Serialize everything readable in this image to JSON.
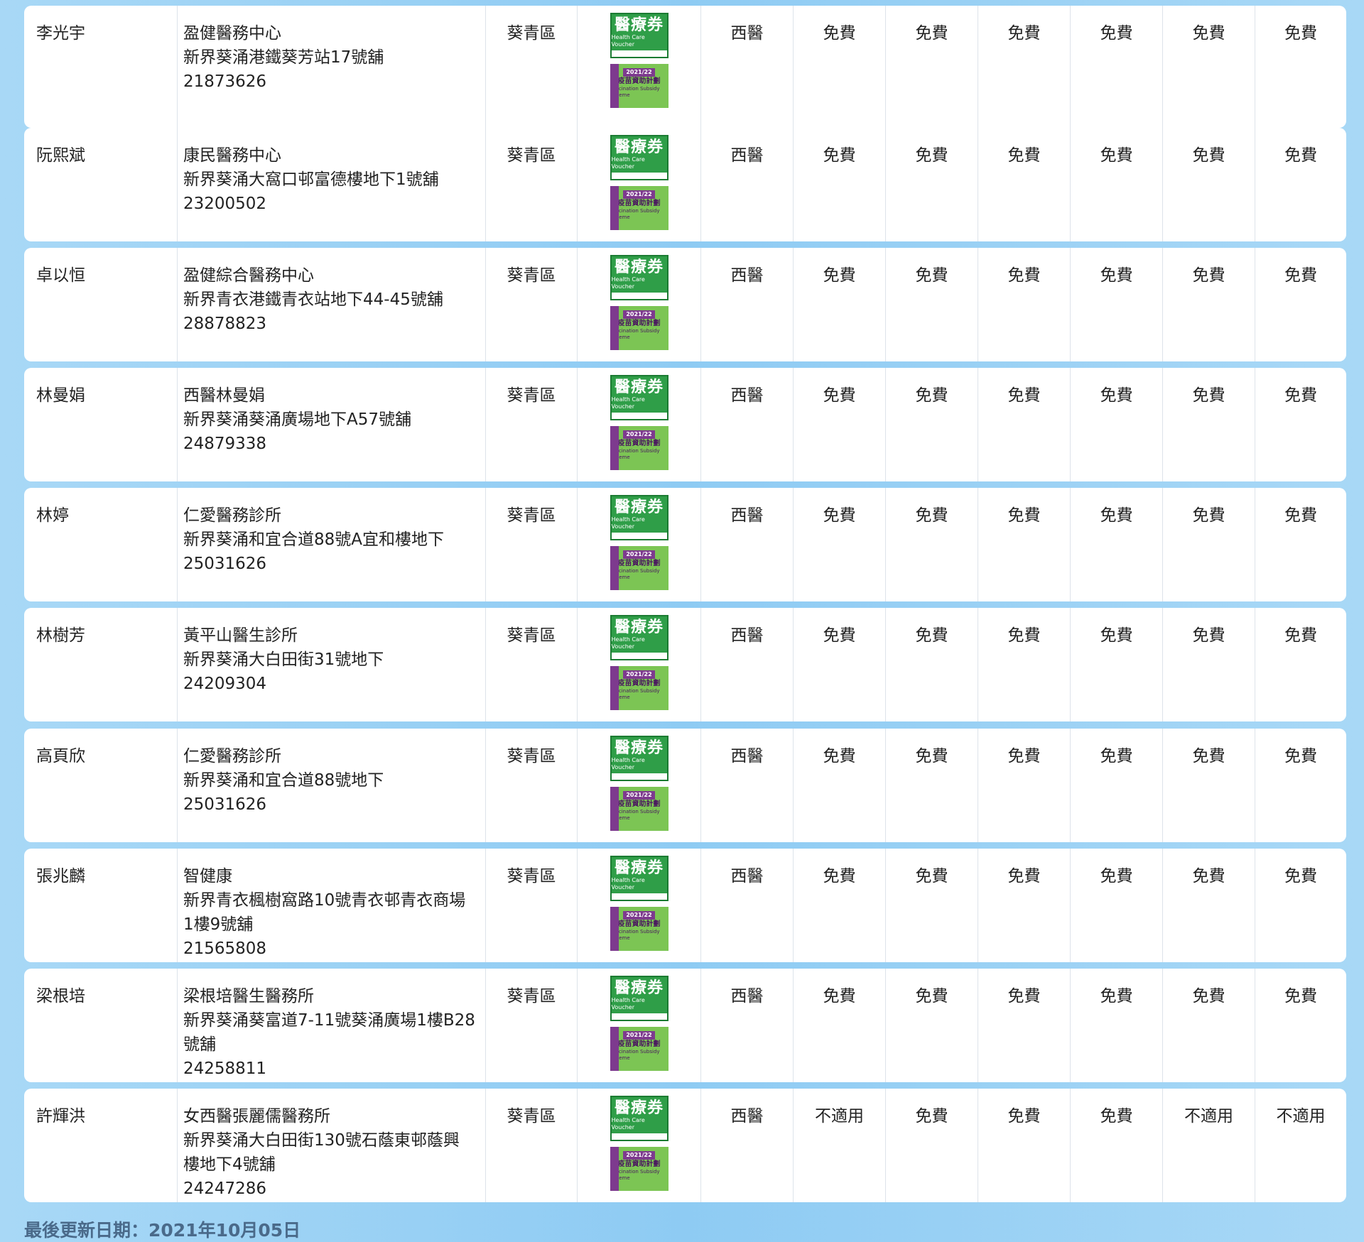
{
  "badges": {
    "hcv_title": "醫療券",
    "hcv_sub": "Health Care Voucher",
    "vss_year": "2021/22",
    "vss_title": "疫苗資助計劃",
    "vss_sub": "Vaccination Subsidy Scheme"
  },
  "rows": [
    {
      "doctor": "李光宇",
      "clinic": "盈健醫務中心",
      "address": "新界葵涌港鐵葵芳站17號舖",
      "address2": "",
      "phone": "21873626",
      "district": "葵青區",
      "type": "西醫",
      "fees": [
        "免費",
        "免費",
        "免費",
        "免費",
        "免費",
        "免費"
      ]
    },
    {
      "doctor": "阮熙斌",
      "clinic": "康民醫務中心",
      "address": "新界葵涌大窩口邨富德樓地下1號舖",
      "address2": "",
      "phone": "23200502",
      "district": "葵青區",
      "type": "西醫",
      "fees": [
        "免費",
        "免費",
        "免費",
        "免費",
        "免費",
        "免費"
      ]
    },
    {
      "doctor": "卓以恒",
      "clinic": "盈健綜合醫務中心",
      "address": "新界青衣港鐵青衣站地下44-45號舖",
      "address2": "",
      "phone": "28878823",
      "district": "葵青區",
      "type": "西醫",
      "fees": [
        "免費",
        "免費",
        "免費",
        "免費",
        "免費",
        "免費"
      ]
    },
    {
      "doctor": "林曼娟",
      "clinic": "西醫林曼娟",
      "address": "新界葵涌葵涌廣場地下A57號舖",
      "address2": "",
      "phone": "24879338",
      "district": "葵青區",
      "type": "西醫",
      "fees": [
        "免費",
        "免費",
        "免費",
        "免費",
        "免費",
        "免費"
      ]
    },
    {
      "doctor": "林婷",
      "clinic": "仁愛醫務診所",
      "address": "新界葵涌和宜合道88號A宜和樓地下",
      "address2": "",
      "phone": "25031626",
      "district": "葵青區",
      "type": "西醫",
      "fees": [
        "免費",
        "免費",
        "免費",
        "免費",
        "免費",
        "免費"
      ]
    },
    {
      "doctor": "林樹芳",
      "clinic": "黃平山醫生診所",
      "address": "新界葵涌大白田街31號地下",
      "address2": "",
      "phone": "24209304",
      "district": "葵青區",
      "type": "西醫",
      "fees": [
        "免費",
        "免費",
        "免費",
        "免費",
        "免費",
        "免費"
      ]
    },
    {
      "doctor": "高頁欣",
      "clinic": "仁愛醫務診所",
      "address": "新界葵涌和宜合道88號地下",
      "address2": "",
      "phone": "25031626",
      "district": "葵青區",
      "type": "西醫",
      "fees": [
        "免費",
        "免費",
        "免費",
        "免費",
        "免費",
        "免費"
      ]
    },
    {
      "doctor": "張兆麟",
      "clinic": "智健康",
      "address": "新界青衣楓樹窩路10號青衣邨青衣商場",
      "address2": "1樓9號舖",
      "phone": "21565808",
      "district": "葵青區",
      "type": "西醫",
      "fees": [
        "免費",
        "免費",
        "免費",
        "免費",
        "免費",
        "免費"
      ]
    },
    {
      "doctor": "梁根培",
      "clinic": "梁根培醫生醫務所",
      "address": "新界葵涌葵富道7-11號葵涌廣場1樓B28",
      "address2": "號舖",
      "phone": "24258811",
      "district": "葵青區",
      "type": "西醫",
      "fees": [
        "免費",
        "免費",
        "免費",
        "免費",
        "免費",
        "免費"
      ]
    },
    {
      "doctor": "許輝洪",
      "clinic": "女西醫張麗儒醫務所",
      "address": "新界葵涌大白田街130號石蔭東邨蔭興",
      "address2": "樓地下4號舖",
      "phone": "24247286",
      "district": "葵青區",
      "type": "西醫",
      "fees": [
        "不適用",
        "免費",
        "免費",
        "免費",
        "不適用",
        "不適用"
      ]
    }
  ],
  "footer": {
    "last_updated": "最後更新日期：2021年10月05日"
  }
}
